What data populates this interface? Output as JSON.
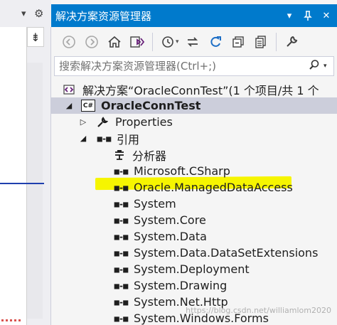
{
  "left": {
    "split_glyph": "⇟",
    "icons": [
      "dropdown-icon",
      "settings-icon"
    ]
  },
  "panel": {
    "title": "解决方案资源管理器",
    "title_buttons": [
      "▾",
      "ᵖ",
      "✕"
    ]
  },
  "toolbar": {
    "icons": [
      "back-icon",
      "forward-icon",
      "home-icon",
      "switch-views-icon",
      "history-icon",
      "sync-icon",
      "refresh-icon",
      "collapse-all-icon",
      "show-all-files-icon",
      "properties-icon"
    ]
  },
  "search": {
    "placeholder": "搜索解决方案资源管理器(Ctrl+;)"
  },
  "tree": {
    "solution_label": "解决方案“OracleConnTest”(1 个项目/共 1 个",
    "project_label": "OracleConnTest",
    "project_icon_text": "C#",
    "properties_label": "Properties",
    "references_label": "引用",
    "references": [
      {
        "label": "分析器",
        "icon": "analyzer-icon"
      },
      {
        "label": "Microsoft.CSharp",
        "icon": "reference-icon"
      },
      {
        "label": "Oracle.ManagedDataAccess",
        "icon": "reference-icon",
        "highlighted": true
      },
      {
        "label": "System",
        "icon": "reference-icon"
      },
      {
        "label": "System.Core",
        "icon": "reference-icon"
      },
      {
        "label": "System.Data",
        "icon": "reference-icon"
      },
      {
        "label": "System.Data.DataSetExtensions",
        "icon": "reference-icon"
      },
      {
        "label": "System.Deployment",
        "icon": "reference-icon"
      },
      {
        "label": "System.Drawing",
        "icon": "reference-icon"
      },
      {
        "label": "System.Net.Http",
        "icon": "reference-icon"
      },
      {
        "label": "System.Windows.Forms",
        "icon": "reference-icon"
      }
    ]
  },
  "watermark": "https://blog.csdn.net/williamlom2020",
  "colors": {
    "accent": "#007acc",
    "highlight": "#f6f500",
    "selected_row": "#cccedb"
  }
}
